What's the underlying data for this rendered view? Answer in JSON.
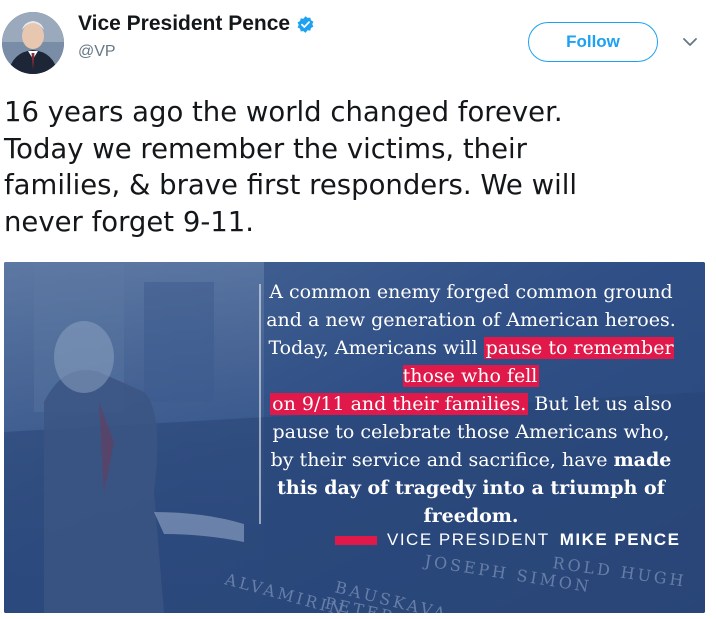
{
  "user": {
    "display_name": "Vice President Pence",
    "handle": "@VP",
    "verified": true
  },
  "follow_button": {
    "label": "Follow"
  },
  "tweet": {
    "text": "16 years ago the world changed forever.\nToday we remember the victims, their\nfamilies, & brave first responders. We will\nnever forget 9-11."
  },
  "media": {
    "quote": {
      "p1": "A common enemy forged common ground and a new generation of American heroes. Today, Americans will ",
      "h1": "pause to remember those who fell",
      "h2": "on 9/11 and their families.",
      "p2": " But let us also pause to celebrate those Americans who, by their service and sacrifice, have ",
      "b1": "made this day of tragedy into a triumph of freedom."
    },
    "attribution": {
      "prefix": "VICE PRESIDENT",
      "name": "MIKE PENCE"
    },
    "engraved_names": [
      "ROLD HUGH",
      "JOSEPH SIMON",
      "ALVAMIRIN",
      "BAUSKAVA",
      "PETER"
    ],
    "colors": {
      "overlay": "#2f4f86",
      "accent": "#e0194a"
    }
  },
  "colors": {
    "brand": "#1da1f2",
    "text": "#14171a",
    "secondary": "#657786"
  }
}
